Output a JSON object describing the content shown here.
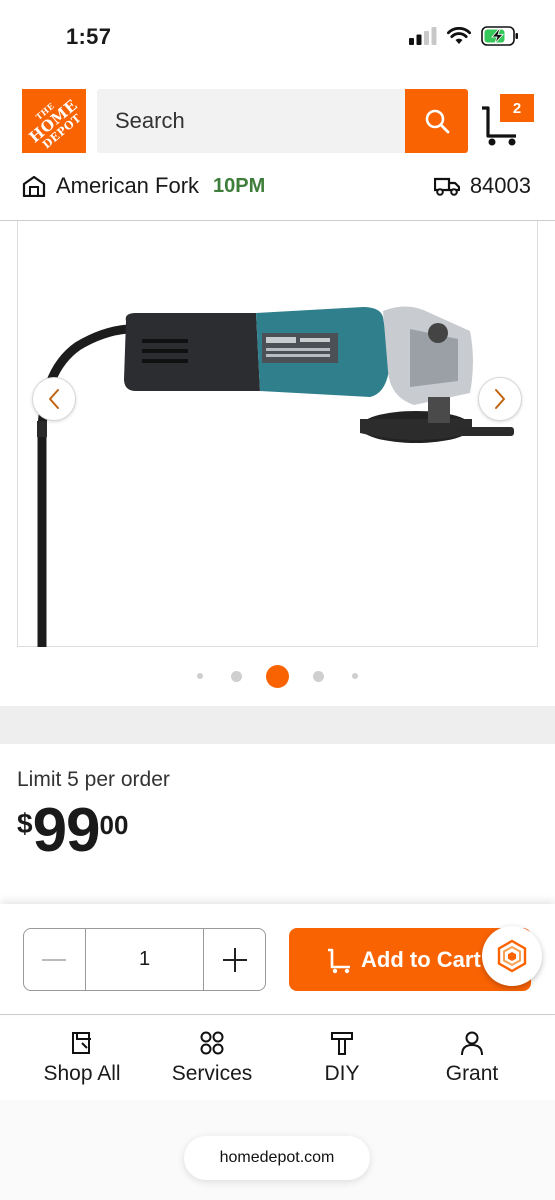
{
  "status_bar": {
    "time": "1:57"
  },
  "header": {
    "logo_text_top": "THE",
    "logo_text_mid": "HOME",
    "logo_text_bottom": "DEPOT",
    "search_placeholder": "Search",
    "cart_count": "2"
  },
  "store": {
    "name": "American Fork",
    "hours": "10PM",
    "zip": "84003"
  },
  "carousel": {
    "active_index": 2,
    "dot_count": 5
  },
  "product": {
    "limit": "Limit 5 per order",
    "price_symbol": "$",
    "price_dollars": "99",
    "price_cents": "00"
  },
  "cart_bar": {
    "quantity": "1",
    "add_label": "Add to Cart"
  },
  "nav": {
    "items": [
      {
        "label": "Shop All",
        "icon": "shop-all-icon"
      },
      {
        "label": "Services",
        "icon": "services-icon"
      },
      {
        "label": "DIY",
        "icon": "diy-hammer-icon"
      },
      {
        "label": "Grant",
        "icon": "person-icon"
      }
    ]
  },
  "browser": {
    "url": "homedepot.com"
  },
  "colors": {
    "brand": "#f96302",
    "store_hours": "#3e7e3a",
    "product_teal": "#2f7f8c"
  }
}
